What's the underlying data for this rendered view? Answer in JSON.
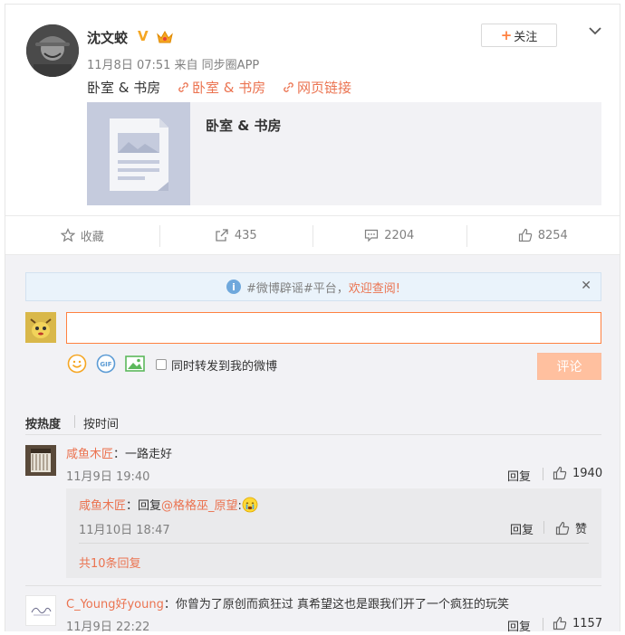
{
  "post": {
    "username": "沈文蛟",
    "verified_badge": "V",
    "follow_label": "+关注",
    "follow_plus": "+",
    "follow_text": "关注",
    "meta": "11月8日 07:51 来自 同步圈APP",
    "content_text": "卧室 & 书房",
    "links": [
      "卧室 & 书房",
      "网页链接"
    ],
    "preview_title": "卧室 & 书房"
  },
  "actions": [
    {
      "icon": "star-icon",
      "label": "收藏"
    },
    {
      "icon": "share-icon",
      "label": "435"
    },
    {
      "icon": "comment-icon",
      "label": "2204"
    },
    {
      "icon": "like-icon",
      "label": "8254"
    }
  ],
  "comment_area": {
    "notice_prefix": "#微博辟谣#平台，",
    "notice_highlight": "欢迎查阅!",
    "input_value": "",
    "forward_label": "同时转发到我的微博",
    "submit_label": "评论"
  },
  "sort": {
    "hot": "按热度",
    "time": "按时间"
  },
  "comments": [
    {
      "name": "咸鱼木匠",
      "text": "：一路走好",
      "time": "11月9日 19:40",
      "reply_label": "回复",
      "likes": "1940",
      "replies": [
        {
          "name": "咸鱼木匠",
          "prefix": "：回复",
          "mention": "@格格巫_原望",
          "suffix": ":",
          "time": "11月10日 18:47",
          "reply_label": "回复",
          "like_label": "赞"
        }
      ],
      "more_replies": "共10条回复"
    },
    {
      "name": "C_Young好young",
      "text": "：你曾为了原创而疯狂过 真希望这也是跟我们开了一个疯狂的玩笑",
      "time": "11月9日 22:22",
      "reply_label": "回复",
      "likes": "1157"
    }
  ],
  "colors": {
    "accent": "#eb7350",
    "muted": "#808080",
    "panel": "#f2f2f5",
    "submit_disabled": "#ffc09f"
  }
}
